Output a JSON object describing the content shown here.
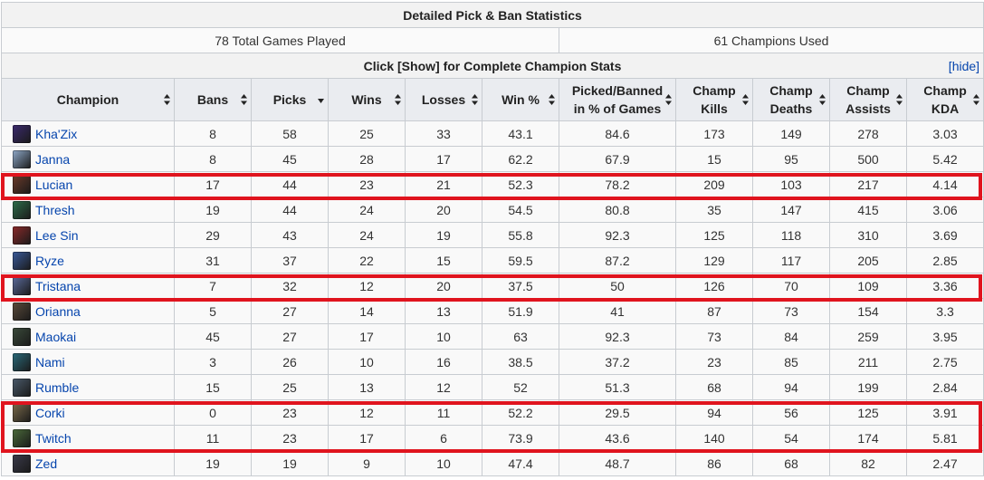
{
  "title": "Detailed Pick & Ban Statistics",
  "summary": {
    "games": "78 Total Games Played",
    "champions": "61 Champions Used"
  },
  "show_text": "Click [Show] for Complete Champion Stats",
  "hide_link": {
    "open": "[",
    "label": "hide",
    "close": "]"
  },
  "columns": {
    "champion": "Champion",
    "bans": "Bans",
    "picks": "Picks",
    "wins": "Wins",
    "losses": "Losses",
    "winpct": "Win %",
    "pickban_l1": "Picked/Banned",
    "pickban_l2": "in % of Games",
    "kills_l1": "Champ",
    "kills_l2": "Kills",
    "deaths_l1": "Champ",
    "deaths_l2": "Deaths",
    "assists_l1": "Champ",
    "assists_l2": "Assists",
    "kda_l1": "Champ",
    "kda_l2": "KDA"
  },
  "rows": [
    {
      "name": "Kha'Zix",
      "color": "#3b2a6e",
      "bans": "8",
      "picks": "58",
      "wins": "25",
      "losses": "33",
      "winpct": "43.1",
      "pickban": "84.6",
      "kills": "173",
      "deaths": "149",
      "assists": "278",
      "kda": "3.03"
    },
    {
      "name": "Janna",
      "color": "#8fa9c9",
      "bans": "8",
      "picks": "45",
      "wins": "28",
      "losses": "17",
      "winpct": "62.2",
      "pickban": "67.9",
      "kills": "15",
      "deaths": "95",
      "assists": "500",
      "kda": "5.42"
    },
    {
      "name": "Lucian",
      "color": "#6b3a2a",
      "bans": "17",
      "picks": "44",
      "wins": "23",
      "losses": "21",
      "winpct": "52.3",
      "pickban": "78.2",
      "kills": "209",
      "deaths": "103",
      "assists": "217",
      "kda": "4.14"
    },
    {
      "name": "Thresh",
      "color": "#2f6e4a",
      "bans": "19",
      "picks": "44",
      "wins": "24",
      "losses": "20",
      "winpct": "54.5",
      "pickban": "80.8",
      "kills": "35",
      "deaths": "147",
      "assists": "415",
      "kda": "3.06"
    },
    {
      "name": "Lee Sin",
      "color": "#8a2a2a",
      "bans": "29",
      "picks": "43",
      "wins": "24",
      "losses": "19",
      "winpct": "55.8",
      "pickban": "92.3",
      "kills": "125",
      "deaths": "118",
      "assists": "310",
      "kda": "3.69"
    },
    {
      "name": "Ryze",
      "color": "#3a5a9a",
      "bans": "31",
      "picks": "37",
      "wins": "22",
      "losses": "15",
      "winpct": "59.5",
      "pickban": "87.2",
      "kills": "129",
      "deaths": "117",
      "assists": "205",
      "kda": "2.85"
    },
    {
      "name": "Tristana",
      "color": "#5a6a9a",
      "bans": "7",
      "picks": "32",
      "wins": "12",
      "losses": "20",
      "winpct": "37.5",
      "pickban": "50",
      "kills": "126",
      "deaths": "70",
      "assists": "109",
      "kda": "3.36"
    },
    {
      "name": "Orianna",
      "color": "#5a4a3a",
      "bans": "5",
      "picks": "27",
      "wins": "14",
      "losses": "13",
      "winpct": "51.9",
      "pickban": "41",
      "kills": "87",
      "deaths": "73",
      "assists": "154",
      "kda": "3.3"
    },
    {
      "name": "Maokai",
      "color": "#3a4a3a",
      "bans": "45",
      "picks": "27",
      "wins": "17",
      "losses": "10",
      "winpct": "63",
      "pickban": "92.3",
      "kills": "73",
      "deaths": "84",
      "assists": "259",
      "kda": "3.95"
    },
    {
      "name": "Nami",
      "color": "#2a6a7a",
      "bans": "3",
      "picks": "26",
      "wins": "10",
      "losses": "16",
      "winpct": "38.5",
      "pickban": "37.2",
      "kills": "23",
      "deaths": "85",
      "assists": "211",
      "kda": "2.75"
    },
    {
      "name": "Rumble",
      "color": "#4a5a6a",
      "bans": "15",
      "picks": "25",
      "wins": "13",
      "losses": "12",
      "winpct": "52",
      "pickban": "51.3",
      "kills": "68",
      "deaths": "94",
      "assists": "199",
      "kda": "2.84"
    },
    {
      "name": "Corki",
      "color": "#7a6a4a",
      "bans": "0",
      "picks": "23",
      "wins": "12",
      "losses": "11",
      "winpct": "52.2",
      "pickban": "29.5",
      "kills": "94",
      "deaths": "56",
      "assists": "125",
      "kda": "3.91"
    },
    {
      "name": "Twitch",
      "color": "#4a6a3a",
      "bans": "11",
      "picks": "23",
      "wins": "17",
      "losses": "6",
      "winpct": "73.9",
      "pickban": "43.6",
      "kills": "140",
      "deaths": "54",
      "assists": "174",
      "kda": "5.81"
    },
    {
      "name": "Zed",
      "color": "#3a3a4a",
      "bans": "19",
      "picks": "19",
      "wins": "9",
      "losses": "10",
      "winpct": "47.4",
      "pickban": "48.7",
      "kills": "86",
      "deaths": "68",
      "assists": "82",
      "kda": "2.47"
    }
  ],
  "colors": {
    "highlight": "#e0141e",
    "link": "#0645ad"
  }
}
